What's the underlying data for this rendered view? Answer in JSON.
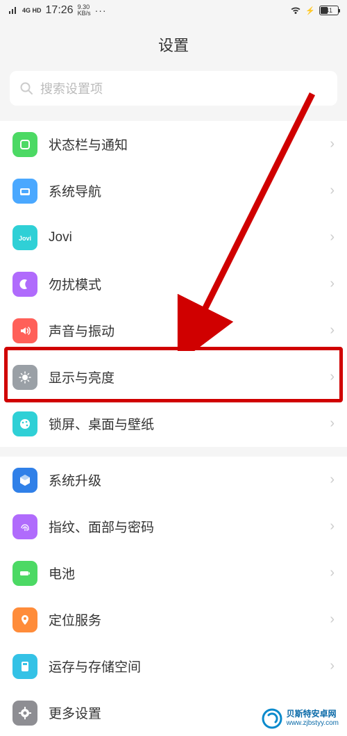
{
  "status_bar": {
    "network": "4G HD",
    "time": "17:26",
    "net_speed_value": "9.30",
    "net_speed_unit": "KB/s",
    "dots": "···",
    "battery_pct": "41"
  },
  "header": {
    "title": "设置"
  },
  "search": {
    "placeholder": "搜索设置项"
  },
  "groups": [
    {
      "items": [
        {
          "id": "status-notification",
          "label": "状态栏与通知",
          "icon": "status-icon",
          "color": "ic-green"
        },
        {
          "id": "system-nav",
          "label": "系统导航",
          "icon": "nav-icon",
          "color": "ic-blue"
        },
        {
          "id": "jovi",
          "label": "Jovi",
          "icon": "jovi-icon",
          "color": "ic-cyan"
        },
        {
          "id": "dnd",
          "label": "勿扰模式",
          "icon": "moon-icon",
          "color": "ic-purple"
        },
        {
          "id": "sound",
          "label": "声音与振动",
          "icon": "sound-icon",
          "color": "ic-red"
        },
        {
          "id": "display",
          "label": "显示与亮度",
          "icon": "brightness-icon",
          "color": "ic-grey"
        },
        {
          "id": "lockscreen",
          "label": "锁屏、桌面与壁纸",
          "icon": "palette-icon",
          "color": "ic-cyan"
        }
      ]
    },
    {
      "items": [
        {
          "id": "update",
          "label": "系统升级",
          "icon": "update-icon",
          "color": "ic-darkblue"
        },
        {
          "id": "biometrics",
          "label": "指纹、面部与密码",
          "icon": "fingerprint-icon",
          "color": "ic-purple"
        },
        {
          "id": "battery",
          "label": "电池",
          "icon": "battery-icon",
          "color": "ic-greenbat"
        },
        {
          "id": "location",
          "label": "定位服务",
          "icon": "location-icon",
          "color": "ic-loc"
        },
        {
          "id": "storage",
          "label": "运存与存储空间",
          "icon": "storage-icon",
          "color": "ic-cyan2"
        },
        {
          "id": "more",
          "label": "更多设置",
          "icon": "gear-icon",
          "color": "ic-grey2"
        }
      ]
    }
  ],
  "annotation": {
    "highlight_item_id": "display",
    "arrow_color": "#d00000"
  },
  "watermark": {
    "name": "贝斯特安卓网",
    "url": "www.zjbstyy.com"
  }
}
